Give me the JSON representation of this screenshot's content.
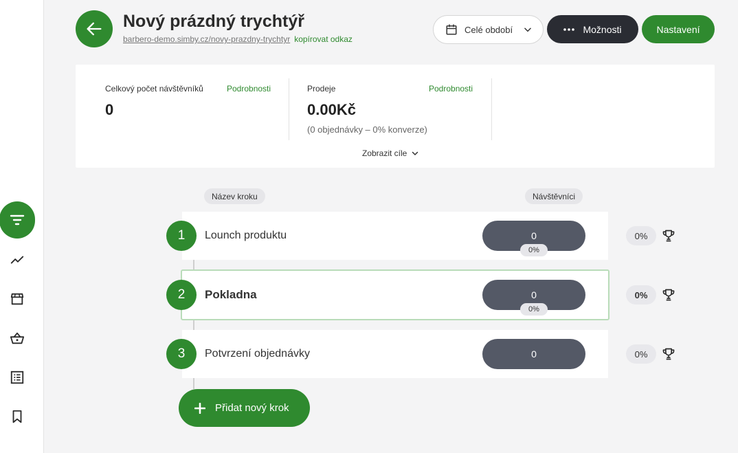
{
  "header": {
    "title": "Nový prázdný trychtýř",
    "url": "barbero-demo.simby.cz/novy-prazdny-trychtyr",
    "copy_link": "kopírovat odkaz",
    "period_label": "Celé období",
    "options_label": "Možnosti",
    "settings_label": "Nastavení"
  },
  "stats": {
    "visitors_label": "Celkový počet návštěvníků",
    "visitors_details": "Podrobnosti",
    "visitors_value": "0",
    "sales_label": "Prodeje",
    "sales_details": "Podrobnosti",
    "sales_value": "0.00Kč",
    "sales_sub": "(0 objednávky – 0% konverze)",
    "goals_toggle": "Zobrazit cíle"
  },
  "columns": {
    "step_name": "Název kroku",
    "visitors": "Návštěvníci"
  },
  "steps": [
    {
      "num": "1",
      "name": "Lounch produktu",
      "visitors": "0",
      "visitors_pct": "0%",
      "conversion": "0%"
    },
    {
      "num": "2",
      "name": "Pokladna",
      "visitors": "0",
      "visitors_pct": "0%",
      "conversion": "0%"
    },
    {
      "num": "3",
      "name": "Potvrzení objednávky",
      "visitors": "0",
      "conversion": "0%"
    }
  ],
  "add_step_label": "Přidat nový krok",
  "sidebar": {
    "icons": [
      "funnel-icon",
      "trend-icon",
      "store-icon",
      "basket-icon",
      "list-icon",
      "bookmark-icon"
    ]
  },
  "colors": {
    "accent": "#2f8a2f",
    "dark": "#2a2c33",
    "pill": "#545966"
  }
}
